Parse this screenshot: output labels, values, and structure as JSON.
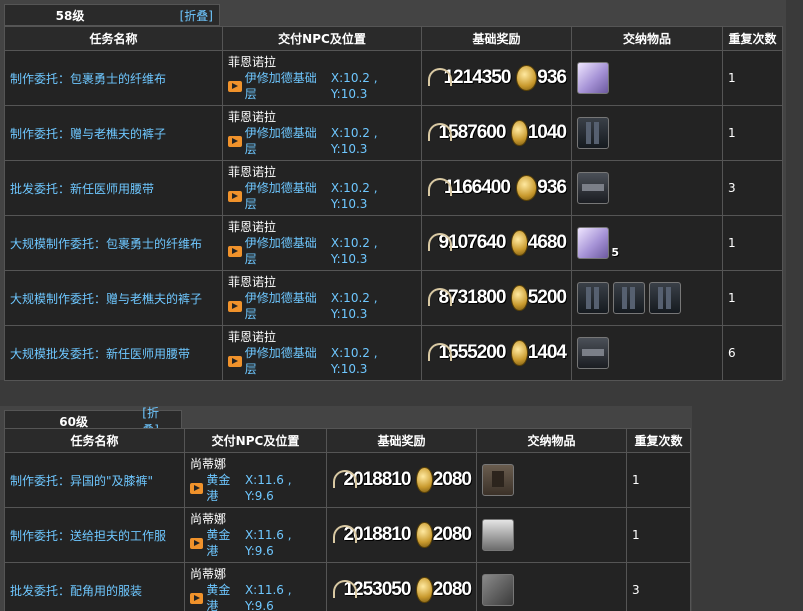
{
  "sections": [
    {
      "level": "58级",
      "fold": "[折叠]",
      "headers": [
        "任务名称",
        "交付NPC及位置",
        "基础奖励",
        "交纳物品",
        "重复次数"
      ],
      "rows": [
        {
          "name": "制作委托：包裹勇士的纤维布",
          "npc": "菲恩诺拉",
          "place": "伊修加德基础层",
          "coord": "X:10.2 , Y:10.3",
          "exp": "1214350",
          "gil": "936",
          "items": [
            {
              "icon": "cloth-item-icon",
              "qty": ""
            }
          ],
          "repeat": "1"
        },
        {
          "name": "制作委托：赠与老樵夫的裤子",
          "npc": "菲恩诺拉",
          "place": "伊修加德基础层",
          "coord": "X:10.2 , Y:10.3",
          "exp": "1587600",
          "gil": "1040",
          "items": [
            {
              "icon": "pants-item-icon",
              "qty": ""
            }
          ],
          "repeat": "1"
        },
        {
          "name": "批发委托：新任医师用腰带",
          "npc": "菲恩诺拉",
          "place": "伊修加德基础层",
          "coord": "X:10.2 , Y:10.3",
          "exp": "1166400",
          "gil": "936",
          "items": [
            {
              "icon": "belt-item-icon",
              "qty": ""
            }
          ],
          "repeat": "3"
        },
        {
          "name": "大规模制作委托：包裹勇士的纤维布",
          "npc": "菲恩诺拉",
          "place": "伊修加德基础层",
          "coord": "X:10.2 , Y:10.3",
          "exp": "9107640",
          "gil": "4680",
          "items": [
            {
              "icon": "cloth-item-icon",
              "qty": "5"
            }
          ],
          "repeat": "1"
        },
        {
          "name": "大规模制作委托：赠与老樵夫的裤子",
          "npc": "菲恩诺拉",
          "place": "伊修加德基础层",
          "coord": "X:10.2 , Y:10.3",
          "exp": "8731800",
          "gil": "5200",
          "items": [
            {
              "icon": "pants-item-icon",
              "qty": ""
            },
            {
              "icon": "pants-item-icon",
              "qty": ""
            },
            {
              "icon": "pants-item-icon",
              "qty": ""
            }
          ],
          "repeat": "1"
        },
        {
          "name": "大规模批发委托：新任医师用腰带",
          "npc": "菲恩诺拉",
          "place": "伊修加德基础层",
          "coord": "X:10.2 , Y:10.3",
          "exp": "1555200",
          "gil": "1404",
          "items": [
            {
              "icon": "belt-item-icon",
              "qty": ""
            }
          ],
          "repeat": "6"
        }
      ]
    },
    {
      "level": "60级",
      "fold": "[折叠]",
      "headers": [
        "任务名称",
        "交付NPC及位置",
        "基础奖励",
        "交纳物品",
        "重复次数"
      ],
      "rows": [
        {
          "name": "制作委托：异国的\"及膝裤\"",
          "npc": "尚蒂娜",
          "place": "黄金港",
          "coord": "X:11.6 , Y:9.6",
          "exp": "2018810",
          "gil": "2080",
          "items": [
            {
              "icon": "shorts-item-icon",
              "qty": ""
            }
          ],
          "repeat": "1"
        },
        {
          "name": "制作委托：送给担夫的工作服",
          "npc": "尚蒂娜",
          "place": "黄金港",
          "coord": "X:11.6 , Y:9.6",
          "exp": "2018810",
          "gil": "2080",
          "items": [
            {
              "icon": "outfit-item-icon",
              "qty": ""
            }
          ],
          "repeat": "1"
        },
        {
          "name": "批发委托：配角用的服装",
          "npc": "尚蒂娜",
          "place": "黄金港",
          "coord": "X:11.6 , Y:9.6",
          "exp": "1253050",
          "gil": "2080",
          "items": [
            {
              "icon": "gear-item-icon",
              "qty": ""
            }
          ],
          "repeat": "3"
        }
      ]
    }
  ]
}
